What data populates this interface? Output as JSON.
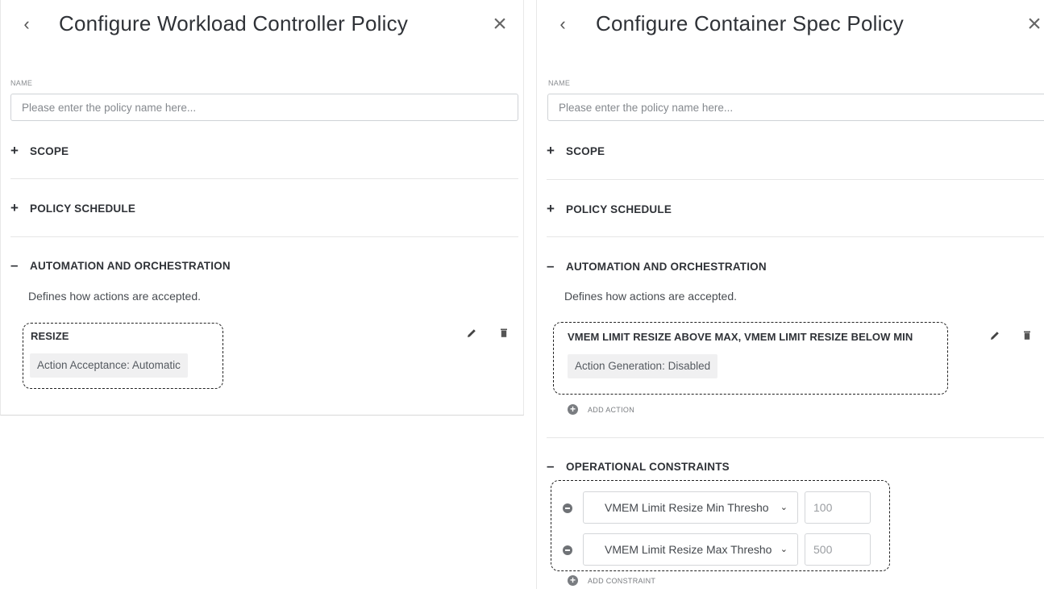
{
  "left_panel": {
    "title": "Configure Workload Controller Policy",
    "back_icon": "chevron-left-icon",
    "close_icon": "close-icon",
    "name_label": "NAME",
    "name_placeholder": "Please enter the policy name here...",
    "name_value": "",
    "sections": {
      "scope": "SCOPE",
      "policy_schedule": "POLICY SCHEDULE",
      "automation": "AUTOMATION AND ORCHESTRATION"
    },
    "section_signs": {
      "scope": "+",
      "policy_schedule": "+",
      "automation": "–"
    },
    "automation_description": "Defines how actions are accepted.",
    "action": {
      "title": "RESIZE",
      "chip": "Action Acceptance: Automatic"
    }
  },
  "right_panel": {
    "title": "Configure Container Spec Policy",
    "back_icon": "chevron-left-icon",
    "close_icon": "close-icon",
    "name_label": "NAME",
    "name_placeholder": "Please enter the policy name here...",
    "name_value": "",
    "sections": {
      "scope": "SCOPE",
      "policy_schedule": "POLICY SCHEDULE",
      "automation": "AUTOMATION AND ORCHESTRATION",
      "operational_constraints": "OPERATIONAL CONSTRAINTS"
    },
    "section_signs": {
      "scope": "+",
      "policy_schedule": "+",
      "automation": "–",
      "operational_constraints": "–"
    },
    "automation_description": "Defines how actions are accepted.",
    "action": {
      "title": "VMEM LIMIT RESIZE ABOVE MAX, VMEM LIMIT RESIZE BELOW MIN",
      "chip": "Action Generation: Disabled"
    },
    "add_action_label": "ADD ACTION",
    "constraints": [
      {
        "select": "VMEM Limit Resize Min Thresho",
        "value": "100"
      },
      {
        "select": "VMEM Limit Resize Max Thresho",
        "value": "500"
      }
    ],
    "add_constraint_label": "ADD CONSTRAINT"
  },
  "glyphs": {
    "back": "‹",
    "close": "×",
    "caret": "⌄",
    "plus": "+"
  },
  "colors": {
    "text": "#2f3237",
    "muted": "#85898e",
    "chip_bg": "#f0f0f1",
    "border": "#cfd2d6"
  }
}
